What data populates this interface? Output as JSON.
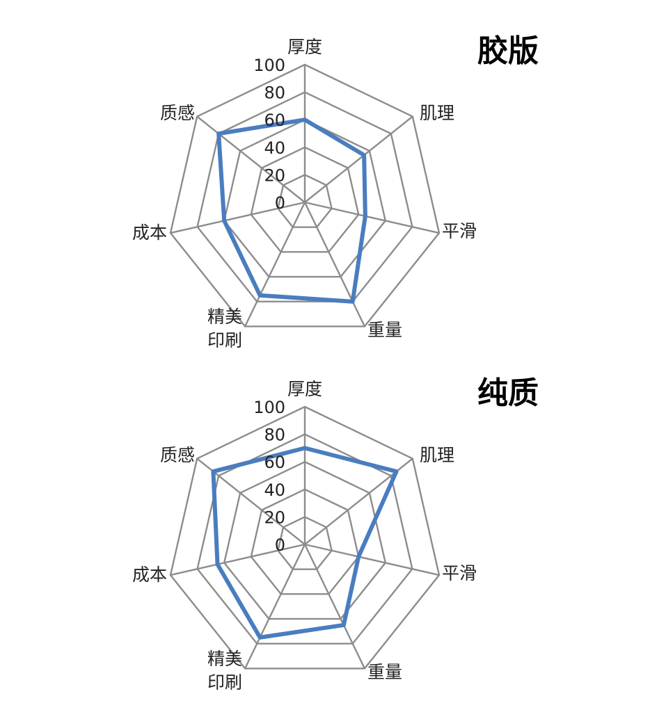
{
  "chart_data": [
    {
      "type": "radar",
      "title": "胶版",
      "categories": [
        "厚度",
        "肌理",
        "平滑",
        "重量",
        "精美\n印刷",
        "成本",
        "质感"
      ],
      "series": [
        {
          "values": [
            60,
            55,
            45,
            80,
            75,
            60,
            80
          ]
        }
      ],
      "ticks": [
        "0",
        "20",
        "40",
        "60",
        "80",
        "100"
      ],
      "rlim": [
        0,
        100
      ],
      "grid": true,
      "series_color": "#4a7dbf",
      "grid_color": "#8c8c8c"
    },
    {
      "type": "radar",
      "title": "纯质",
      "categories": [
        "厚度",
        "肌理",
        "平滑",
        "重量",
        "精美\n印刷",
        "成本",
        "质感"
      ],
      "series": [
        {
          "values": [
            70,
            85,
            40,
            65,
            75,
            65,
            85
          ]
        }
      ],
      "ticks": [
        "0",
        "20",
        "40",
        "60",
        "80",
        "100"
      ],
      "rlim": [
        0,
        100
      ],
      "grid": true,
      "series_color": "#4a7dbf",
      "grid_color": "#8c8c8c"
    }
  ]
}
